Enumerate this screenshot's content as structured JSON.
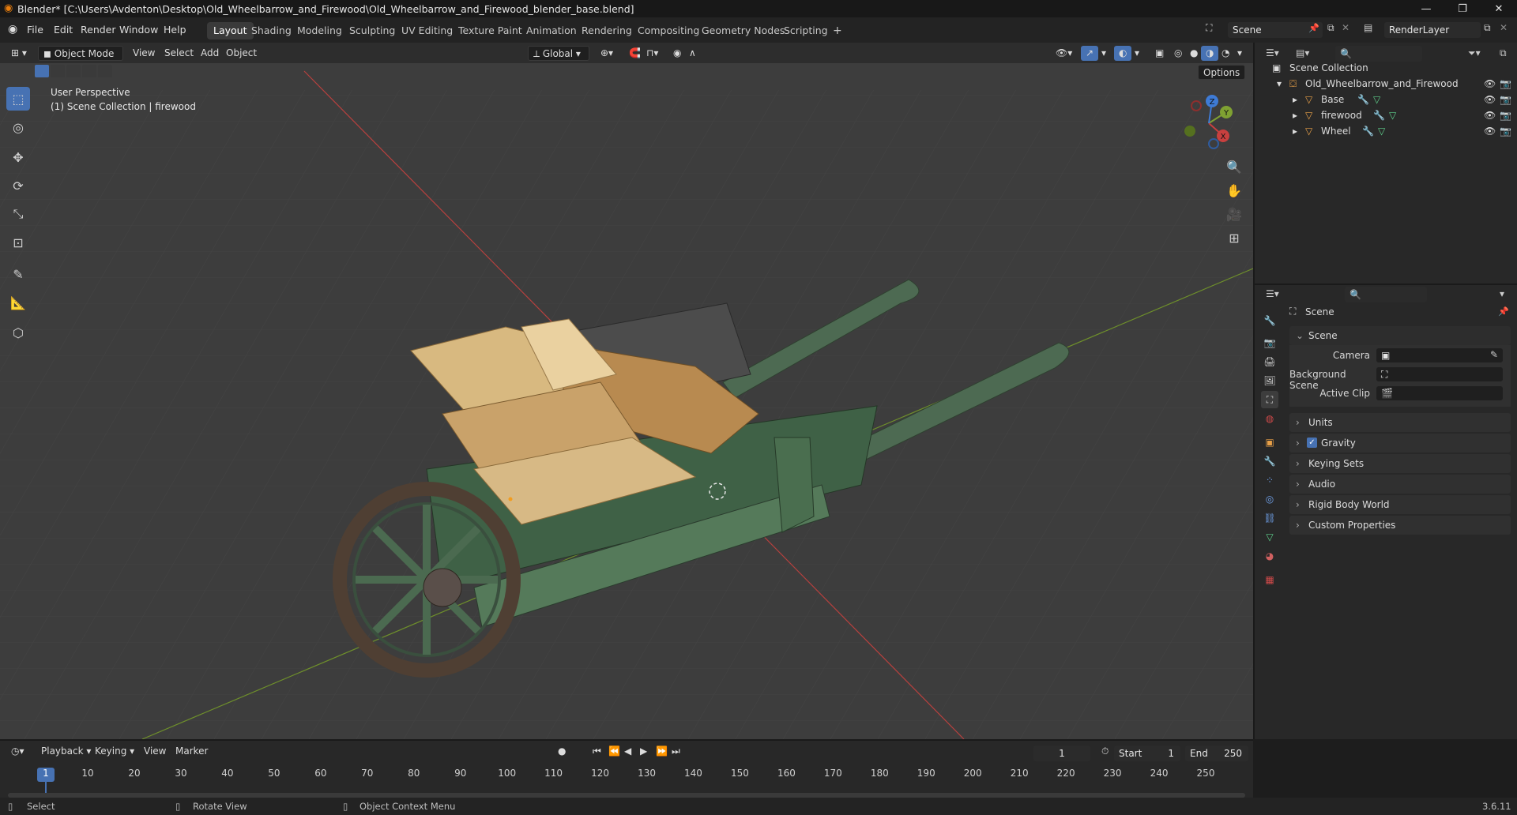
{
  "titlebar": {
    "title": "Blender* [C:\\Users\\Avdenton\\Desktop\\Old_Wheelbarrow_and_Firewood\\Old_Wheelbarrow_and_Firewood_blender_base.blend]",
    "minimize": "—",
    "maximize": "❐",
    "close": "✕"
  },
  "menu": [
    "File",
    "Edit",
    "Render",
    "Window",
    "Help"
  ],
  "workspaces": [
    "Layout",
    "Shading",
    "Modeling",
    "Sculpting",
    "UV Editing",
    "Texture Paint",
    "Animation",
    "Rendering",
    "Compositing",
    "Geometry Nodes",
    "Scripting"
  ],
  "active_workspace": "Layout",
  "add_workspace": "+",
  "scene_field": "Scene",
  "renderlayer_field": "RenderLayer",
  "viewport_header": {
    "mode": "Object Mode",
    "menus": [
      "View",
      "Select",
      "Add",
      "Object"
    ],
    "orientation": "Global",
    "options": "Options"
  },
  "viewport_overlay": {
    "perspective": "User Perspective",
    "collection": "(1) Scene Collection | firewood"
  },
  "gizmo": {
    "x": "X",
    "y": "Y",
    "z": "Z"
  },
  "outliner": {
    "root": "Scene Collection",
    "collection": "Old_Wheelbarrow_and_Firewood",
    "objects": [
      "Base",
      "firewood",
      "Wheel"
    ]
  },
  "properties": {
    "context": "Scene",
    "panel_header": "Scene",
    "fields": [
      {
        "label": "Camera",
        "value": ""
      },
      {
        "label": "Background Scene",
        "value": ""
      },
      {
        "label": "Active Clip",
        "value": ""
      }
    ],
    "collapsed_panels": [
      "Units",
      "Gravity",
      "Keying Sets",
      "Audio",
      "Rigid Body World",
      "Custom Properties"
    ]
  },
  "timeline": {
    "menus": [
      "Playback",
      "Keying",
      "View",
      "Marker"
    ],
    "current_frame": "1",
    "start_label": "Start",
    "start": "1",
    "end_label": "End",
    "end": "250",
    "ticks": [
      "1",
      "10",
      "20",
      "30",
      "40",
      "50",
      "60",
      "70",
      "80",
      "90",
      "100",
      "110",
      "120",
      "130",
      "140",
      "150",
      "160",
      "170",
      "180",
      "190",
      "200",
      "210",
      "220",
      "230",
      "240",
      "250"
    ]
  },
  "statusbar": {
    "select": "Select",
    "rotate": "Rotate View",
    "context_menu": "Object Context Menu",
    "version": "3.6.11"
  },
  "colors": {
    "accent": "#4772b3",
    "viewport_bg": "#3c3c3c",
    "panel_bg": "#282828",
    "x_axis": "#c8403f",
    "y_axis": "#7fa132",
    "z_axis": "#3e7bd6"
  }
}
